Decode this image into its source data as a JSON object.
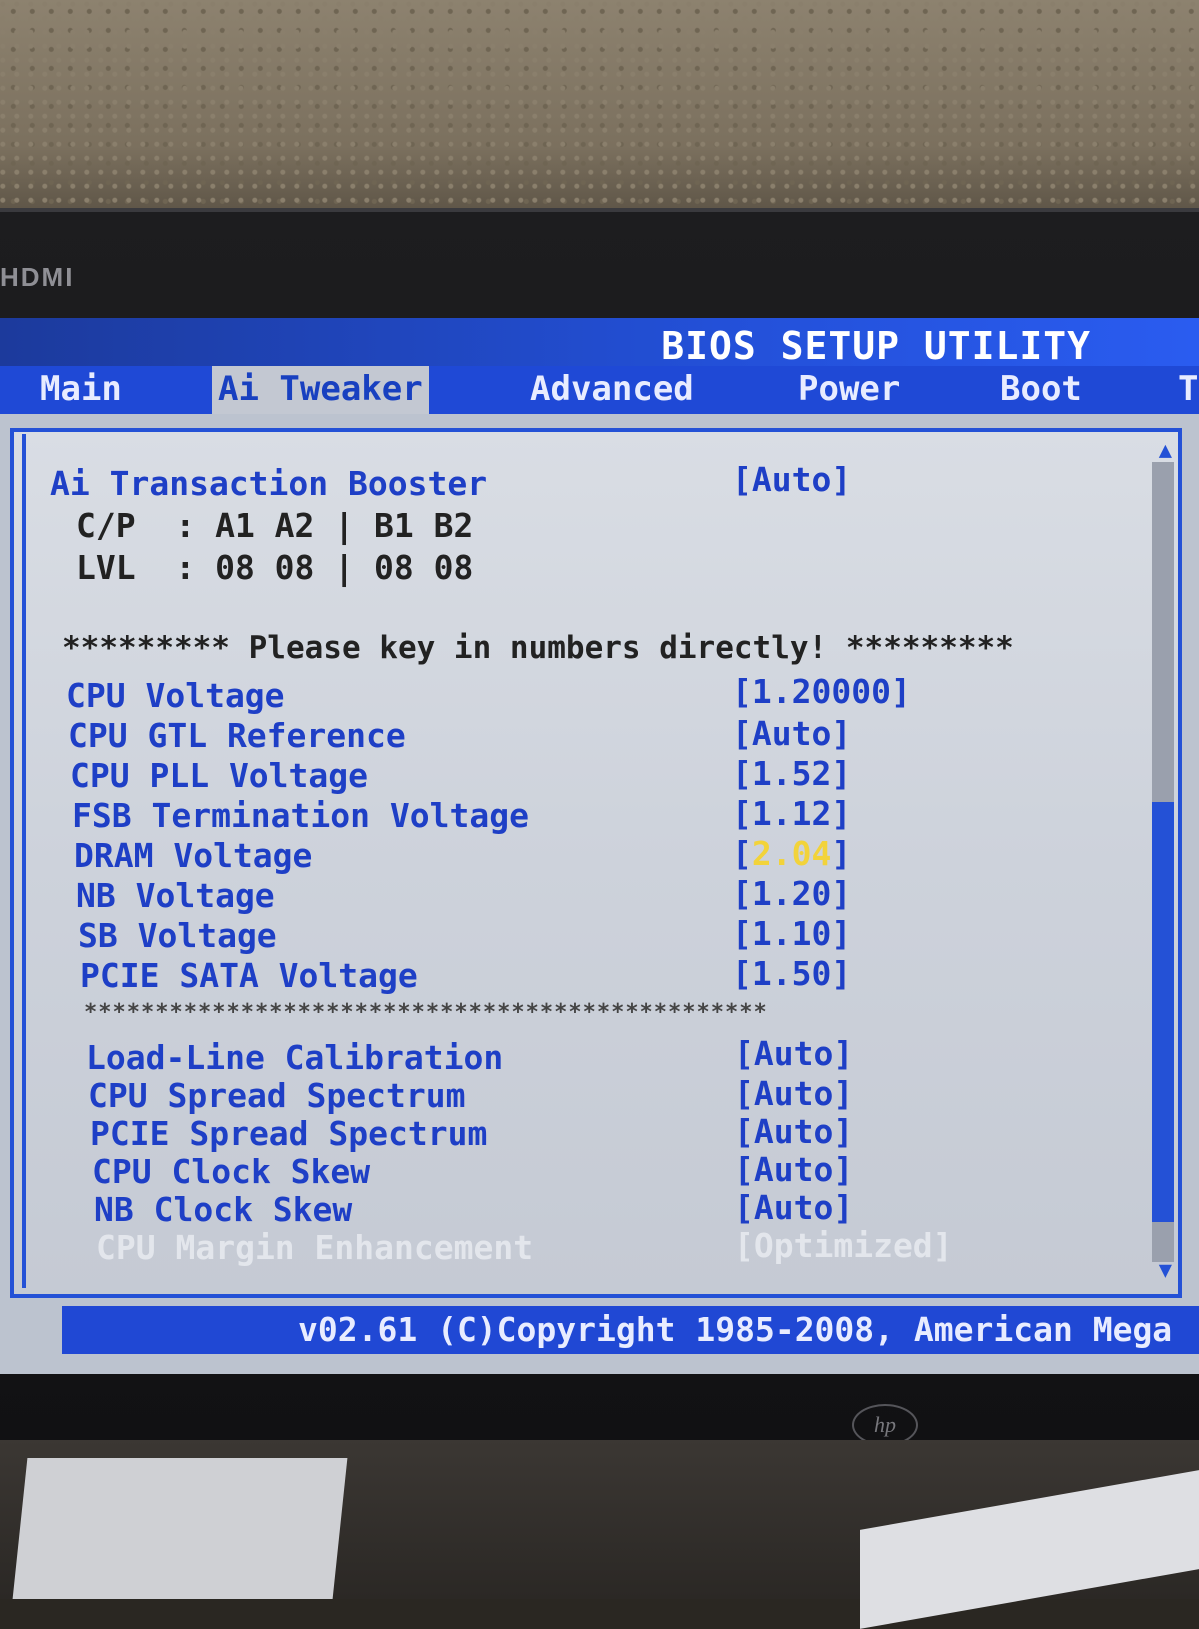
{
  "hardware": {
    "port_label": "HDMI",
    "brand_logo": "hp"
  },
  "bios": {
    "title": "BIOS SETUP UTILITY",
    "tabs": [
      {
        "label": "Main",
        "active": false
      },
      {
        "label": "Ai Tweaker",
        "active": true
      },
      {
        "label": "Advanced",
        "active": false
      },
      {
        "label": "Power",
        "active": false
      },
      {
        "label": "Boot",
        "active": false
      },
      {
        "label": "T",
        "active": false
      }
    ],
    "booster": {
      "label": "Ai Transaction Booster",
      "value": "[Auto]",
      "cp_line": "C/P  : A1 A2 | B1 B2",
      "lvl_line": "LVL  : 08 08 | 08 08"
    },
    "notice": "********* Please key in numbers directly! *********",
    "voltage_settings": [
      {
        "label": "CPU Voltage",
        "value": "[1.20000]"
      },
      {
        "label": "CPU GTL Reference",
        "value": "[Auto]"
      },
      {
        "label": "CPU PLL Voltage",
        "value": "[1.52]"
      },
      {
        "label": "FSB Termination Voltage",
        "value": "[1.12]"
      },
      {
        "label": "DRAM Voltage",
        "value_open": "[",
        "value_highlight": "2.04",
        "value_close": "]"
      },
      {
        "label": "NB Voltage",
        "value": "[1.20]"
      },
      {
        "label": "SB Voltage",
        "value": "[1.10]"
      },
      {
        "label": "PCIE SATA Voltage",
        "value": "[1.50]"
      }
    ],
    "separator": "************************************************",
    "other_settings": [
      {
        "label": "Load-Line Calibration",
        "value": "[Auto]"
      },
      {
        "label": "CPU Spread Spectrum",
        "value": "[Auto]"
      },
      {
        "label": "PCIE Spread Spectrum",
        "value": "[Auto]"
      },
      {
        "label": "CPU Clock Skew",
        "value": "[Auto]"
      },
      {
        "label": "NB Clock Skew",
        "value": "[Auto]"
      },
      {
        "label": "CPU Margin Enhancement",
        "value": "[Optimized]"
      }
    ],
    "scroll": {
      "up_arrow": "▲",
      "down_arrow": "▼"
    },
    "footer": "v02.61 (C)Copyright 1985-2008, American Mega"
  }
}
